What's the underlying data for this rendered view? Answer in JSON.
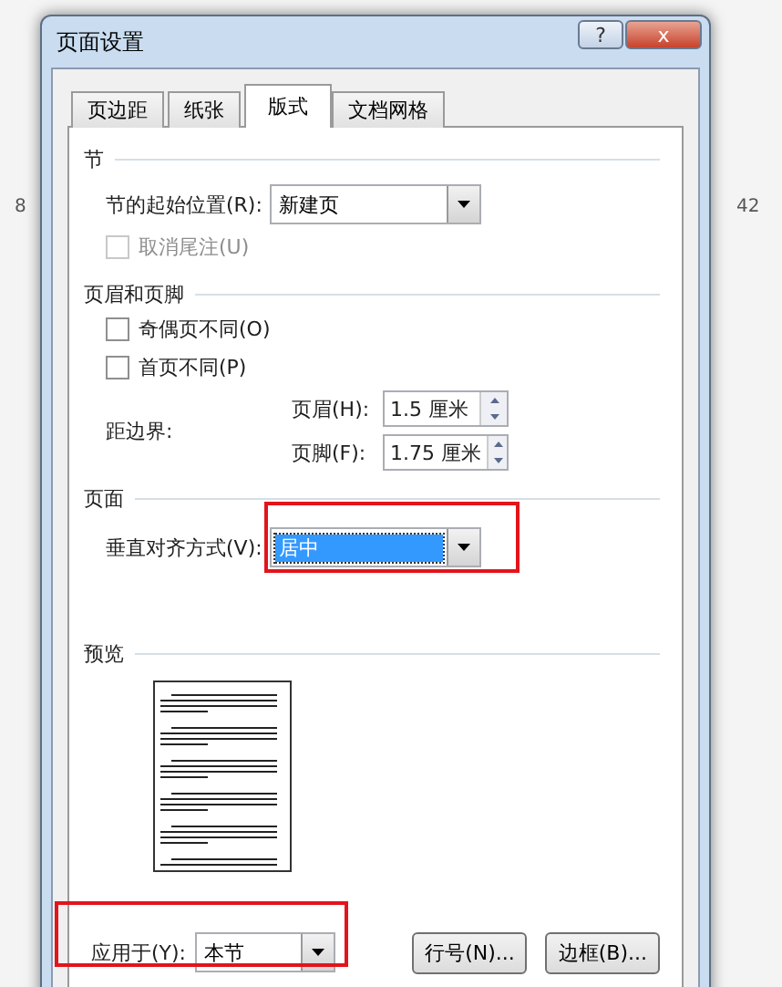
{
  "background": {
    "ruler_numbers": [
      "8",
      "42"
    ]
  },
  "window": {
    "title": "页面设置",
    "help_label": "?",
    "close_label": "x"
  },
  "tabs": [
    {
      "label": "页边距",
      "selected": false
    },
    {
      "label": "纸张",
      "selected": false
    },
    {
      "label": "版式",
      "selected": true
    },
    {
      "label": "文档网格",
      "selected": false
    }
  ],
  "section": {
    "heading": "节",
    "start_label": "节的起始位置(R):",
    "start_value": "新建页",
    "suppress_endnotes": {
      "label": "取消尾注(U)",
      "checked": false,
      "disabled": true
    }
  },
  "headers_footers": {
    "heading": "页眉和页脚",
    "options": [
      {
        "label": "奇偶页不同(O)",
        "checked": false,
        "disabled": false
      },
      {
        "label": "首页不同(P)",
        "checked": false,
        "disabled": false
      }
    ],
    "from_edge_label": "距边界:",
    "header_label": "页眉(H):",
    "header_value": "1.5 厘米",
    "footer_label": "页脚(F):",
    "footer_value": "1.75 厘米"
  },
  "page": {
    "heading": "页面",
    "valign_label": "垂直对齐方式(V):",
    "valign_value": "居中",
    "highlighted": true
  },
  "preview": {
    "heading": "预览"
  },
  "footer": {
    "apply_label": "应用于(Y):",
    "apply_value": "本节",
    "highlighted": true,
    "buttons": [
      "行号(N)...",
      "边框(B)..."
    ]
  }
}
